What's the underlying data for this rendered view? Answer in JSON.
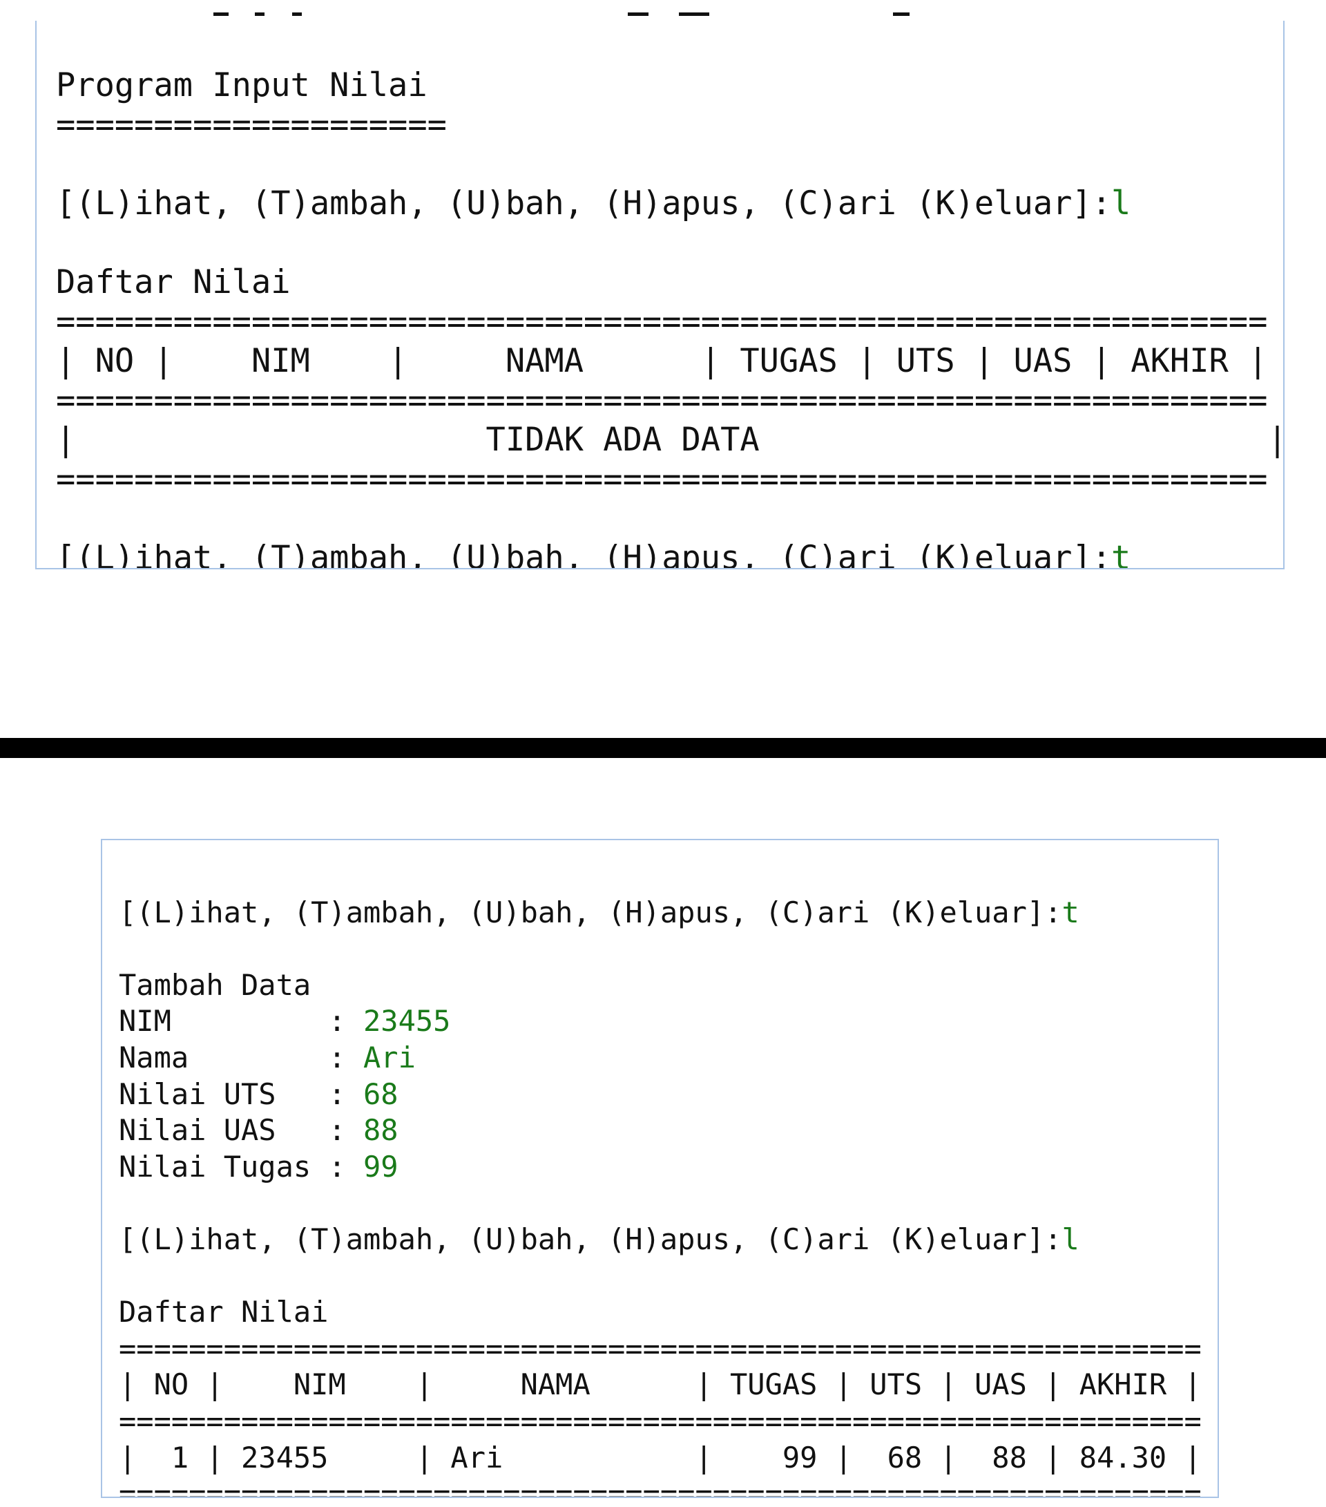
{
  "top_console": {
    "title": "Program Input Nilai",
    "title_underline": "====================",
    "prompt_1": "[(L)ihat, (T)ambah, (U)bah, (H)apus, (C)ari (K)eluar]:",
    "prompt_1_input": "l",
    "list_title": "Daftar Nilai",
    "rule_1": "==============================================================",
    "table_header": "| NO |    NIM    |     NAMA      | TUGAS | UTS | UAS | AKHIR |",
    "rule_2": "==============================================================",
    "empty_row": "|                     TIDAK ADA DATA                          |",
    "rule_3": "==============================================================",
    "prompt_2": "[(L)ihat, (T)ambah, (U)bah, (H)apus, (C)ari (K)eluar]:",
    "prompt_2_input": "t"
  },
  "bottom_console": {
    "prompt_1": "[(L)ihat, (T)ambah, (U)bah, (H)apus, (C)ari (K)eluar]:",
    "prompt_1_input": "t",
    "section_title": "Tambah Data",
    "fields": [
      {
        "label": "NIM         : ",
        "value": "23455"
      },
      {
        "label": "Nama        : ",
        "value": "Ari"
      },
      {
        "label": "Nilai UTS   : ",
        "value": "68"
      },
      {
        "label": "Nilai UAS   : ",
        "value": "88"
      },
      {
        "label": "Nilai Tugas : ",
        "value": "99"
      }
    ],
    "prompt_2": "[(L)ihat, (T)ambah, (U)bah, (H)apus, (C)ari (K)eluar]:",
    "prompt_2_input": "l",
    "list_title": "Daftar Nilai",
    "rule_1": "==============================================================",
    "table_header": "| NO |    NIM    |     NAMA      | TUGAS | UTS | UAS | AKHIR |",
    "rule_2": "==============================================================",
    "data_row": "|  1 | 23455     | Ari           |    99 |  68 |  88 | 84.30 |",
    "rule_3": "=============================================================="
  },
  "colors": {
    "user_input": "#1a7a1a",
    "console_border": "#a9c4e6",
    "divider": "#000000"
  }
}
